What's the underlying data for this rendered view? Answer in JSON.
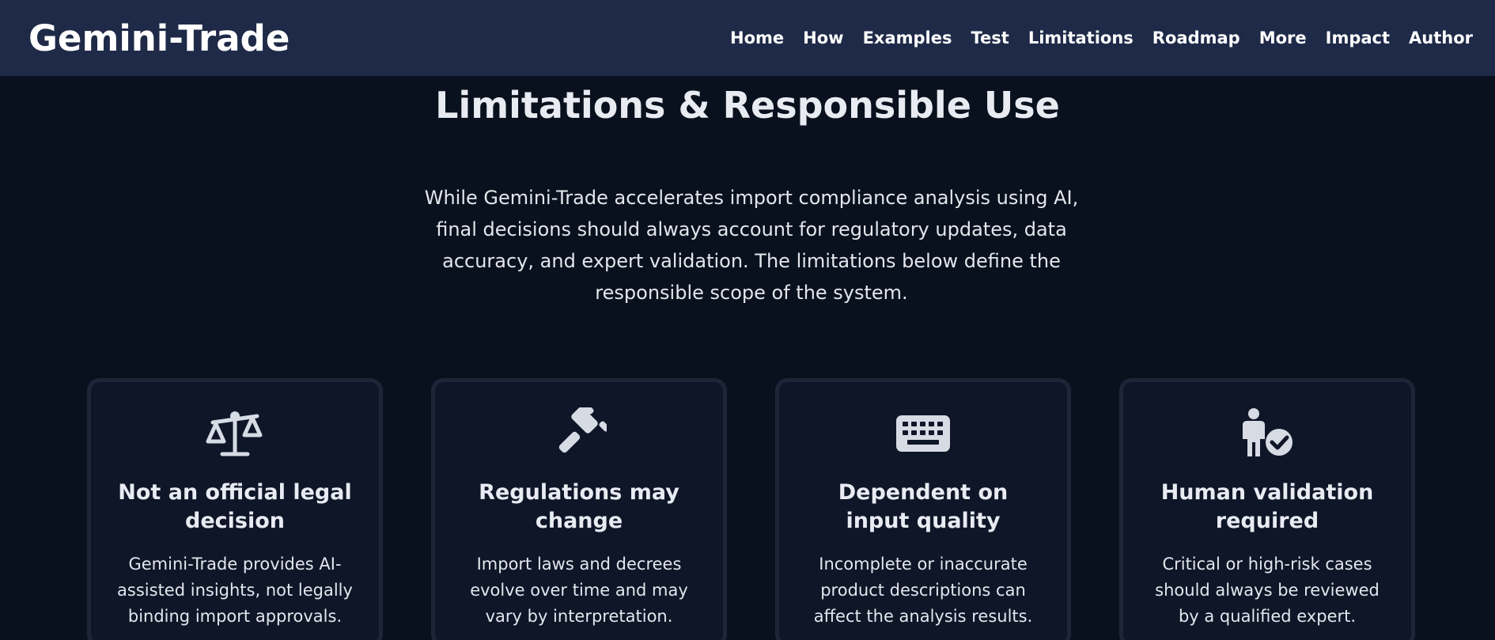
{
  "header": {
    "brand": "Gemini-Trade",
    "nav": [
      "Home",
      "How",
      "Examples",
      "Test",
      "Limitations",
      "Roadmap",
      "More",
      "Impact",
      "Author"
    ]
  },
  "section": {
    "title": "Limitations & Responsible Use",
    "intro": "While Gemini-Trade accelerates import compliance analysis using AI, final decisions should always account for regulatory updates, data accuracy, and expert validation. The limitations below define the responsible scope of the system."
  },
  "cards": [
    {
      "icon": "scale-balance-icon",
      "title": "Not an official legal decision",
      "text": "Gemini-Trade provides AI-assisted insights, not legally binding import approvals."
    },
    {
      "icon": "gavel-icon",
      "title": "Regulations may change",
      "text": "Import laws and decrees evolve over time and may vary by interpretation."
    },
    {
      "icon": "keyboard-icon",
      "title": "Dependent on input quality",
      "text": "Incomplete or inaccurate product descriptions can affect the analysis results."
    },
    {
      "icon": "user-check-icon",
      "title": "Human validation required",
      "text": "Critical or high-risk cases should always be reviewed by a qualified expert."
    }
  ],
  "colors": {
    "header_bg": "#1f2a48",
    "page_bg": "#0a111e",
    "card_bg": "#0e1628",
    "card_border": "#1d2638",
    "icon": "#d6dbe4"
  }
}
